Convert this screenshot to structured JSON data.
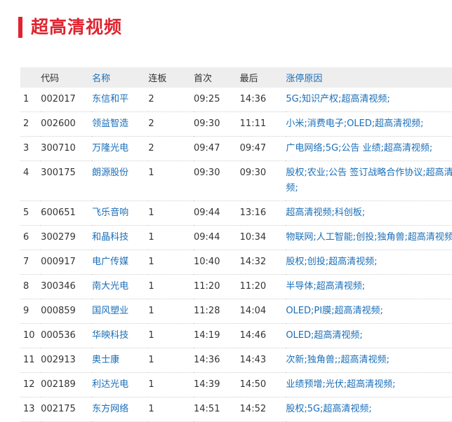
{
  "section": {
    "title": "超高清视频"
  },
  "table": {
    "headers": {
      "index": "",
      "code": "代码",
      "name": "名称",
      "lianban": "连板",
      "first": "首次",
      "last": "最后",
      "reason": "涨停原因"
    },
    "rows": [
      {
        "idx": "1",
        "code": "002017",
        "name": "东信和平",
        "lianban": "2",
        "first": "09:25",
        "last": "14:36",
        "reason": "5G;知识产权;超高清视频;"
      },
      {
        "idx": "2",
        "code": "002600",
        "name": "领益智造",
        "lianban": "2",
        "first": "09:30",
        "last": "11:11",
        "reason": "小米;消费电子;OLED;超高清视频;"
      },
      {
        "idx": "3",
        "code": "300710",
        "name": "万隆光电",
        "lianban": "2",
        "first": "09:47",
        "last": "09:47",
        "reason": "广电网络;5G;公告 业绩;超高清视频;"
      },
      {
        "idx": "4",
        "code": "300175",
        "name": "朗源股份",
        "lianban": "1",
        "first": "09:30",
        "last": "09:30",
        "reason": "股权;农业;公告 签订战略合作协议;超高清视频;"
      },
      {
        "idx": "5",
        "code": "600651",
        "name": "飞乐音响",
        "lianban": "1",
        "first": "09:44",
        "last": "13:16",
        "reason": "超高清视频;科创板;"
      },
      {
        "idx": "6",
        "code": "300279",
        "name": "和晶科技",
        "lianban": "1",
        "first": "09:44",
        "last": "10:34",
        "reason": "物联网;人工智能;创投;独角兽;超高清视频;"
      },
      {
        "idx": "7",
        "code": "000917",
        "name": "电广传媒",
        "lianban": "1",
        "first": "10:40",
        "last": "14:32",
        "reason": "股权;创投;超高清视频;"
      },
      {
        "idx": "8",
        "code": "300346",
        "name": "南大光电",
        "lianban": "1",
        "first": "11:20",
        "last": "11:20",
        "reason": "半导体;超高清视频;"
      },
      {
        "idx": "9",
        "code": "000859",
        "name": "国风塑业",
        "lianban": "1",
        "first": "11:28",
        "last": "14:04",
        "reason": "OLED;PI膜;超高清视频;"
      },
      {
        "idx": "10",
        "code": "000536",
        "name": "华映科技",
        "lianban": "1",
        "first": "14:19",
        "last": "14:46",
        "reason": "OLED;超高清视频;"
      },
      {
        "idx": "11",
        "code": "002913",
        "name": "奥士康",
        "lianban": "1",
        "first": "14:36",
        "last": "14:43",
        "reason": "次新;独角兽;;超高清视频;"
      },
      {
        "idx": "12",
        "code": "002189",
        "name": "利达光电",
        "lianban": "1",
        "first": "14:39",
        "last": "14:50",
        "reason": "业绩预增;光伏;超高清视频;"
      },
      {
        "idx": "13",
        "code": "002175",
        "name": "东方网络",
        "lianban": "1",
        "first": "14:51",
        "last": "14:52",
        "reason": "股权;5G;超高清视频;"
      }
    ]
  },
  "colors": {
    "accent": "#e0242f",
    "link": "#1a6eb8",
    "header_bg": "#eeeeee"
  }
}
